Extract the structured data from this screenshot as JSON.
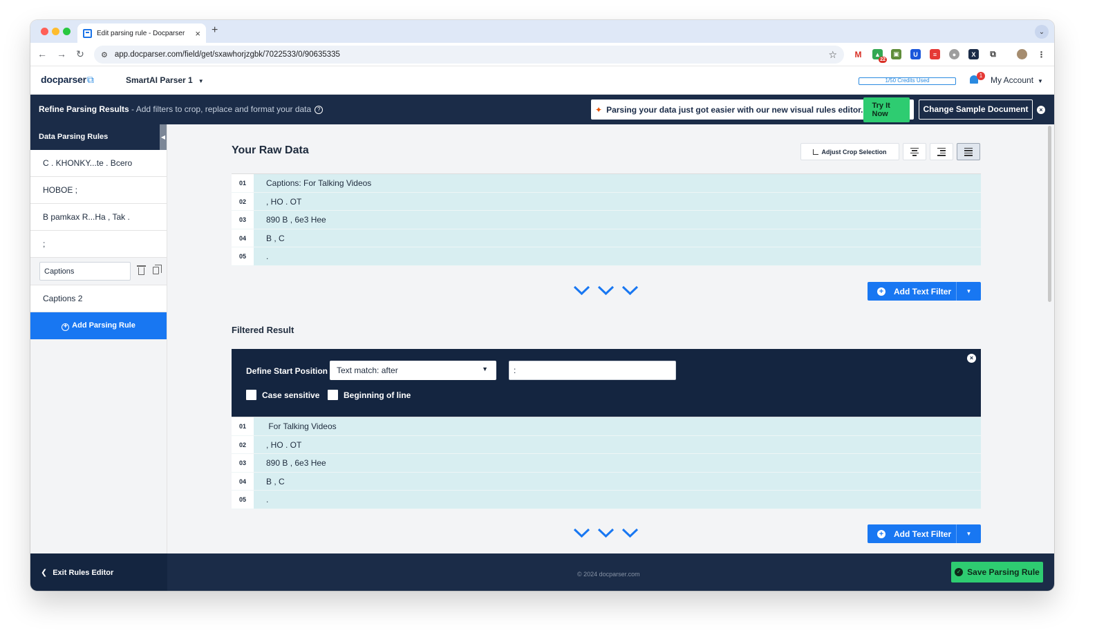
{
  "browser": {
    "tab_title": "Edit parsing rule - Docparser",
    "url": "app.docparser.com/field/get/sxawhorjzgbk/7022533/0/90635335",
    "extension_badge": "22"
  },
  "header": {
    "logo": "docparser",
    "parser_name": "SmartAI Parser 1",
    "credits": "1/50 Credits Used",
    "notifications": "1",
    "account": "My Account"
  },
  "refine_bar": {
    "title": "Refine Parsing Results",
    "subtitle": " - Add filters to crop, replace and format your data",
    "promo_text": "Parsing your data just got easier with our new visual rules editor.",
    "try_button": "Try It Now",
    "change_button": "Change Sample Document"
  },
  "sidebar": {
    "heading": "Data Parsing Rules",
    "items": [
      {
        "label": "C . KHONKY...te . Bcero"
      },
      {
        "label": "HOBOE ;"
      },
      {
        "label": "B pamkax R...Ha , Tak ."
      },
      {
        "label": ";"
      }
    ],
    "editing_value": "Captions",
    "item_after": "Captions 2",
    "add_button": "Add Parsing Rule",
    "exit_label": "Exit Rules Editor"
  },
  "raw_data": {
    "title": "Your Raw Data",
    "crop_button": "Adjust Crop Selection",
    "rows": [
      {
        "num": "01",
        "text": "Captions: For Talking Videos"
      },
      {
        "num": "02",
        "text": ", HO . OT"
      },
      {
        "num": "03",
        "text": "890 B , 6e3 Hee"
      },
      {
        "num": "04",
        "text": "B , C"
      },
      {
        "num": "05",
        "text": "."
      }
    ]
  },
  "filter": {
    "add_button": "Add Text Filter",
    "section_title": "Filtered Result",
    "start_label": "Define Start Position",
    "mode": "Text match: after",
    "match_value": ":",
    "case_sensitive_label": "Case sensitive",
    "case_sensitive": false,
    "beginning_label": "Beginning of line",
    "beginning_of_line": false
  },
  "filtered_data": {
    "rows": [
      {
        "num": "01",
        "text": " For Talking Videos"
      },
      {
        "num": "02",
        "text": ", HO . OT"
      },
      {
        "num": "03",
        "text": "890 B , 6e3 Hee"
      },
      {
        "num": "04",
        "text": "B , C"
      },
      {
        "num": "05",
        "text": "."
      }
    ]
  },
  "footer": {
    "copyright": "© 2024 docparser.com",
    "save_button": "Save Parsing Rule"
  },
  "colors": {
    "navy": "#1b2c48",
    "primary_blue": "#1877f2",
    "accent_green": "#2ecc71",
    "row_tint": "#d8eef1"
  }
}
